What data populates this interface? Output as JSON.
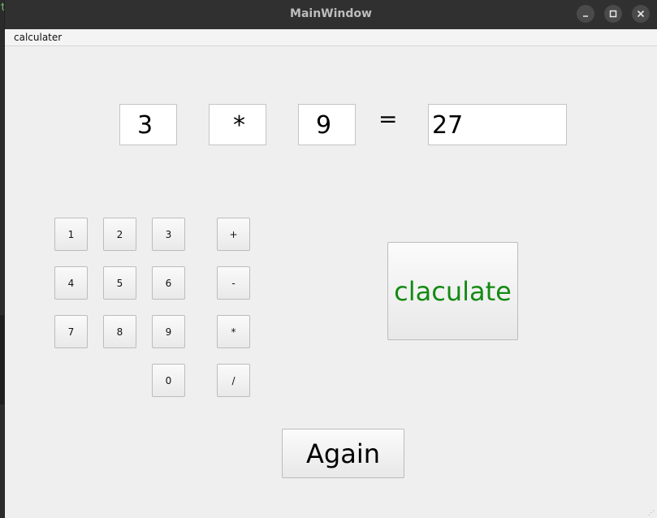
{
  "window": {
    "title": "MainWindow"
  },
  "menu": {
    "items": [
      "calculater"
    ]
  },
  "expression": {
    "operand1": "3",
    "operator": "*",
    "operand2": "9",
    "equals": "=",
    "result": "27"
  },
  "keypad": {
    "digits": [
      "1",
      "2",
      "3",
      "4",
      "5",
      "6",
      "7",
      "8",
      "9",
      "0"
    ],
    "operators": [
      "+",
      "-",
      "*",
      "/"
    ]
  },
  "actions": {
    "calculate_label": "claculate",
    "again_label": "Again"
  },
  "colors": {
    "calculate_text": "#148a14",
    "titlebar": "#303030",
    "window_bg": "#efefef"
  }
}
